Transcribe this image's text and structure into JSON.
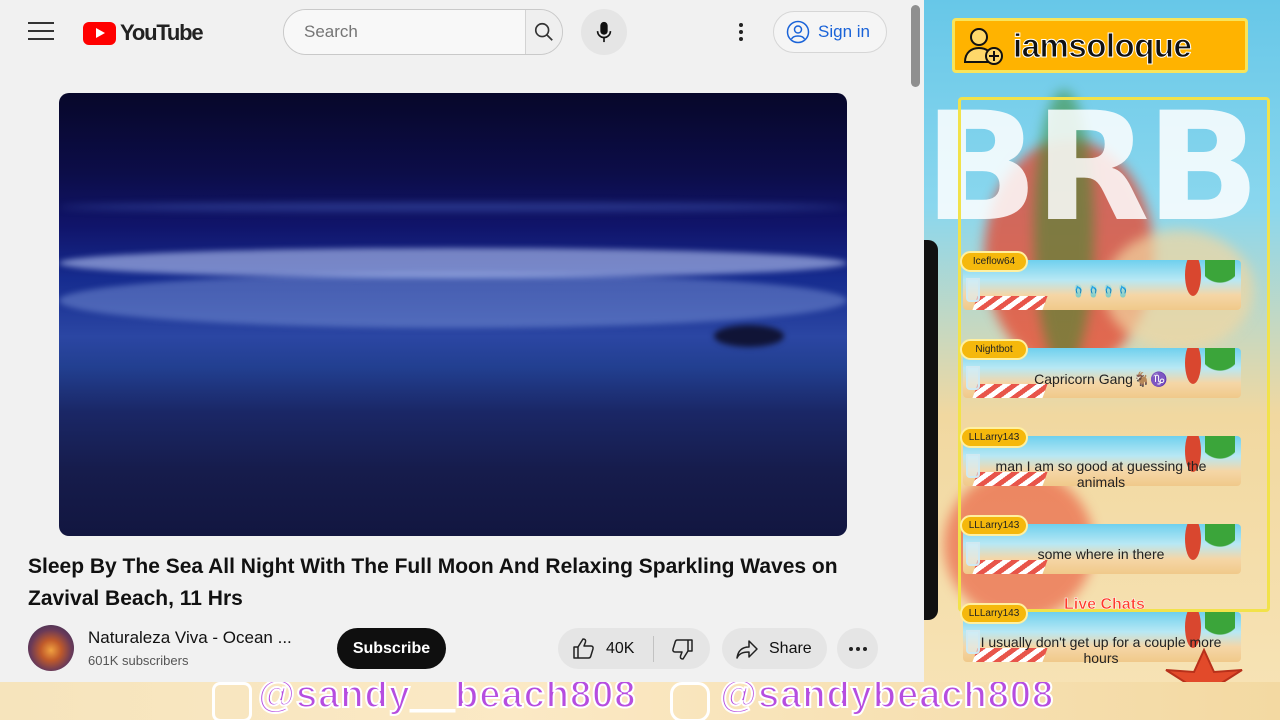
{
  "youtube": {
    "logo_text": "YouTube",
    "search_placeholder": "Search",
    "signin_label": "Sign in",
    "video_title": "Sleep By The Sea All Night With The Full Moon And Relaxing Sparkling Waves on Zavival Beach, 11 Hrs",
    "channel_name": "Naturaleza Viva - Ocean ...",
    "subscribers": "601K subscribers",
    "subscribe_label": "Subscribe",
    "like_count": "40K",
    "share_label": "Share",
    "brand_color": "#ff0000",
    "link_color": "#1a63d8"
  },
  "overlay": {
    "streamer_name": "iamsoloque",
    "brb_text": "BRB",
    "live_chats_label": "Live Chats",
    "messages": [
      {
        "user": "Iceflow64",
        "text": "🩴🩴🩴🩴"
      },
      {
        "user": "Nightbot",
        "text": "Capricorn Gang🐐♑"
      },
      {
        "user": "LLLarry143",
        "text": "man I am so good at guessing the animals"
      },
      {
        "user": "LLLarry143",
        "text": "some where in there"
      },
      {
        "user": "LLLarry143",
        "text": "I usually don't get up for a couple more hours"
      }
    ]
  },
  "banner": {
    "handle_1": "@sandy__beach808",
    "handle_2": "@sandybeach808"
  }
}
